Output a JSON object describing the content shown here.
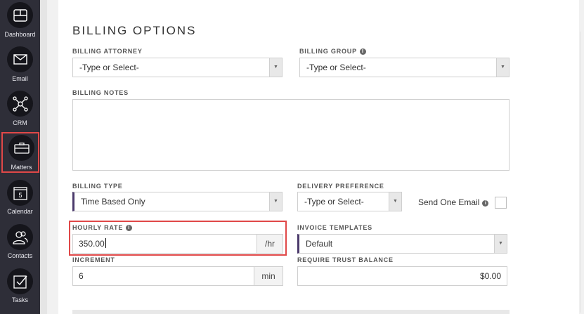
{
  "sidebar": {
    "items": [
      {
        "label": "Dashboard",
        "icon": "dashboard-icon"
      },
      {
        "label": "Email",
        "icon": "envelope-icon"
      },
      {
        "label": "CRM",
        "icon": "network-icon"
      },
      {
        "label": "Matters",
        "icon": "briefcase-icon",
        "active": true
      },
      {
        "label": "Calendar",
        "icon": "calendar-icon",
        "day": "5"
      },
      {
        "label": "Contacts",
        "icon": "people-icon"
      },
      {
        "label": "Tasks",
        "icon": "checkbox-icon"
      }
    ]
  },
  "section_title": "BILLING OPTIONS",
  "fields": {
    "billing_attorney": {
      "label": "BILLING ATTORNEY",
      "value": "-Type or Select-"
    },
    "billing_group": {
      "label": "BILLING GROUP",
      "value": "-Type or Select-"
    },
    "billing_notes": {
      "label": "BILLING NOTES",
      "value": ""
    },
    "billing_type": {
      "label": "BILLING TYPE",
      "value": "Time Based Only"
    },
    "delivery_preference": {
      "label": "DELIVERY PREFERENCE",
      "value": "-Type or Select-"
    },
    "send_one_email": {
      "label": "Send One Email",
      "checked": false
    },
    "hourly_rate": {
      "label": "HOURLY RATE",
      "value": "350.00",
      "suffix": "/hr"
    },
    "invoice_templates": {
      "label": "INVOICE TEMPLATES",
      "value": "Default"
    },
    "increment": {
      "label": "INCREMENT",
      "value": "6",
      "suffix": "min"
    },
    "require_trust_balance": {
      "label": "REQUIRE TRUST BALANCE",
      "value": "$0.00"
    }
  },
  "colors": {
    "sidebar": "#2e2e38",
    "highlight": "#e04848",
    "accent": "#4b3a6b"
  }
}
